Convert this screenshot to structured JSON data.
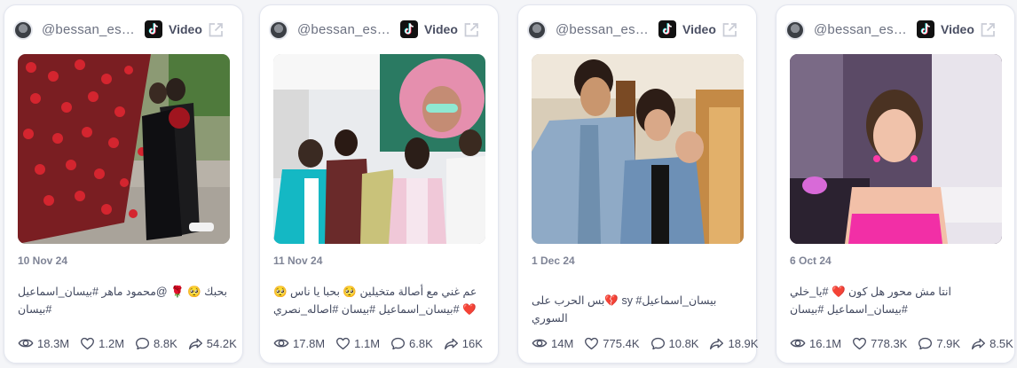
{
  "colors": {
    "accent": "#ff3b5c",
    "text": "#434a60",
    "muted": "#7f8496"
  },
  "cards": [
    {
      "username": "@bessan_esmail",
      "type_label": "Video",
      "date": "10 Nov 24",
      "caption": "بحبك 🥺 🌹 @محمود ماهر #بيسان_اسماعيل #بيسان",
      "views": "18.3M",
      "likes": "1.2M",
      "comments": "8.8K",
      "shares": "54.2K",
      "icons": {
        "views": "eye-icon",
        "likes": "heart-icon",
        "comments": "comment-icon",
        "shares": "share-icon"
      }
    },
    {
      "username": "@bessan_esmail",
      "type_label": "Video",
      "date": "11 Nov 24",
      "caption": "عم غني مع أصالة متخيلين 🥺 بحبا يا ناس 🥺 ❤️ #بيسان_اسماعيل #بيسان #اصاله_نصري",
      "views": "17.8M",
      "likes": "1.1M",
      "comments": "6.8K",
      "shares": "16K",
      "icons": {
        "views": "eye-icon",
        "likes": "heart-icon",
        "comments": "comment-icon",
        "shares": "share-icon"
      }
    },
    {
      "username": "@bessan_esmail",
      "type_label": "Video",
      "date": "1 Dec 24",
      "caption": "بيسان_اسماعيل# sy 💔بس الحرب على السوري",
      "views": "14M",
      "likes": "775.4K",
      "comments": "10.8K",
      "shares": "18.9K",
      "icons": {
        "views": "eye-icon",
        "likes": "heart-icon",
        "comments": "comment-icon",
        "shares": "share-icon"
      }
    },
    {
      "username": "@bessan_esmail",
      "type_label": "Video",
      "date": "6 Oct 24",
      "caption": "انتا مش محور هل كون ❤️ #يا_خلي #بيسان_اسماعيل #بيسان",
      "views": "16.1M",
      "likes": "778.3K",
      "comments": "7.9K",
      "shares": "8.5K",
      "icons": {
        "views": "eye-icon",
        "likes": "heart-icon",
        "comments": "comment-icon",
        "shares": "share-icon"
      }
    }
  ]
}
